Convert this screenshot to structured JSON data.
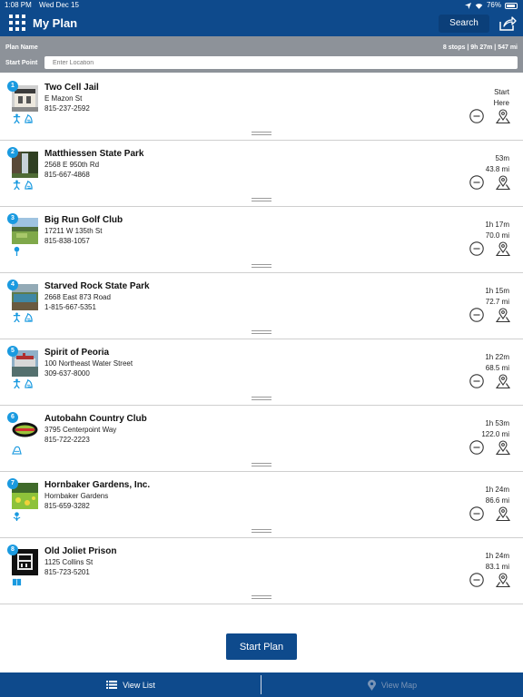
{
  "status_bar": {
    "time": "1:08 PM",
    "date": "Wed Dec 15",
    "battery": "76%"
  },
  "header": {
    "title": "My Plan",
    "search_label": "Search"
  },
  "plan": {
    "name_label": "Plan Name",
    "stats": "8 stops | 9h 27m | 547 mi",
    "start_label": "Start Point",
    "start_placeholder": "Enter Location"
  },
  "stops": [
    {
      "number": "1",
      "name": "Two Cell Jail",
      "address": "E Mazon St",
      "phone": "815-237-2592",
      "time": "Start",
      "distance": "Here",
      "categories": [
        "hiker-icon",
        "history-icon"
      ]
    },
    {
      "number": "2",
      "name": "Matthiessen State Park",
      "address": "2568 E 950th Rd",
      "phone": "815-667-4868",
      "time": "53m",
      "distance": "43.8 mi",
      "categories": [
        "hiker-icon",
        "history-icon"
      ]
    },
    {
      "number": "3",
      "name": "Big Run Golf Club",
      "address": "17211 W 135th St",
      "phone": "815-838-1057",
      "time": "1h 17m",
      "distance": "70.0 mi",
      "categories": [
        "golf-icon"
      ]
    },
    {
      "number": "4",
      "name": "Starved Rock State Park",
      "address": "2668 East 873 Road",
      "phone": "1-815-667-5351",
      "time": "1h 15m",
      "distance": "72.7 mi",
      "categories": [
        "hiker-icon",
        "history-icon"
      ]
    },
    {
      "number": "5",
      "name": "Spirit of Peoria",
      "address": "100 Northeast Water Street",
      "phone": "309-637-8000",
      "time": "1h 22m",
      "distance": "68.5 mi",
      "categories": [
        "hiker-icon",
        "history-icon"
      ]
    },
    {
      "number": "6",
      "name": "Autobahn Country Club",
      "address": "3795 Centerpoint Way",
      "phone": "815-722-2223",
      "time": "1h 53m",
      "distance": "122.0 mi",
      "categories": [
        "racing-icon"
      ]
    },
    {
      "number": "7",
      "name": "Hornbaker Gardens, Inc.",
      "address": "Hornbaker Gardens",
      "phone": "815-659-3282",
      "time": "1h 24m",
      "distance": "86.6 mi",
      "categories": [
        "flower-icon"
      ]
    },
    {
      "number": "8",
      "name": "Old Joliet Prison",
      "address": "1125 Collins St",
      "phone": "815-723-5201",
      "time": "1h 24m",
      "distance": "83.1 mi",
      "categories": [
        "book-icon"
      ]
    }
  ],
  "actions": {
    "start_plan": "Start Plan"
  },
  "tabs": {
    "view_list": "View List",
    "view_map": "View Map"
  },
  "colors": {
    "header": "#0e4a8c",
    "plan_bar": "#8d9299",
    "badge": "#1a9ae0",
    "category": "#1a9ae0",
    "tab_inactive": "#7a94b6"
  }
}
